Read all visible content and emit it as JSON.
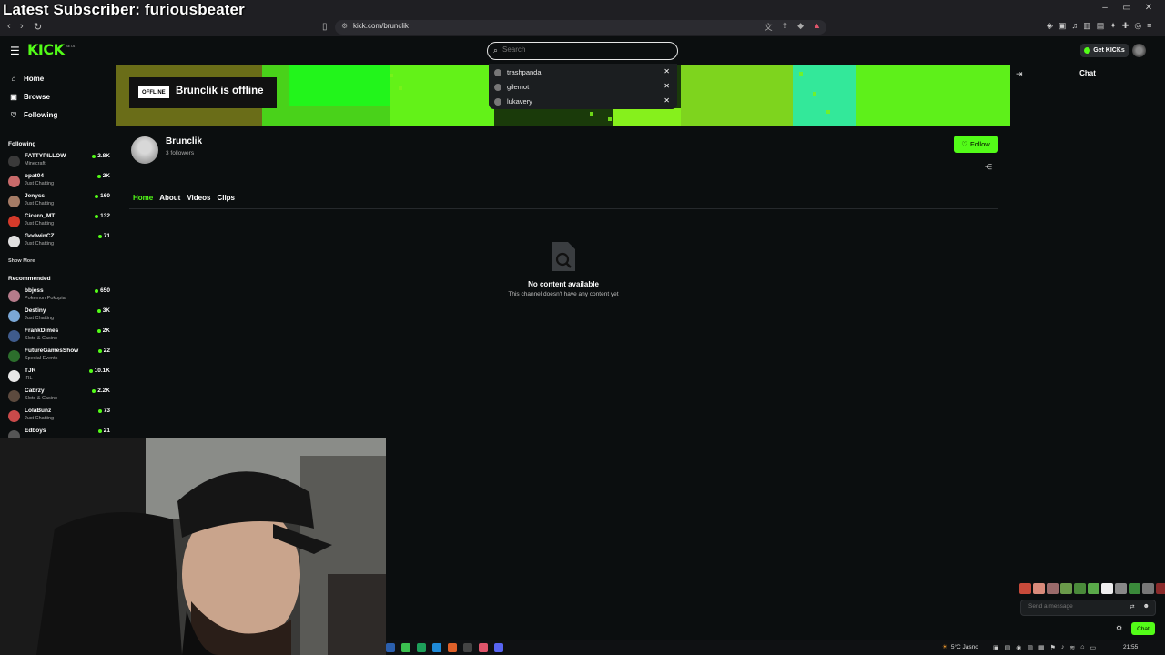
{
  "overlay": {
    "text": "Latest Subscriber: furiousbeater"
  },
  "browser": {
    "url": "kick.com/brunclik",
    "window_controls": [
      "–",
      "▭",
      "✕"
    ]
  },
  "header": {
    "logo": "KICK",
    "beta": "BETA",
    "search_placeholder": "Search",
    "get_kicks": "Get KICKs"
  },
  "search_dropdown": {
    "items": [
      {
        "label": "trashpanda"
      },
      {
        "label": "gilemot"
      },
      {
        "label": "lukavery"
      }
    ]
  },
  "sidebar": {
    "nav": [
      {
        "label": "Home",
        "icon": "home-icon"
      },
      {
        "label": "Browse",
        "icon": "browse-icon"
      },
      {
        "label": "Following",
        "icon": "heart-icon"
      }
    ],
    "following_title": "Following",
    "following": [
      {
        "name": "FATTYPILLOW",
        "category": "Minecraft",
        "viewers": "2.8K",
        "color": "#3a3a3a"
      },
      {
        "name": "opat04",
        "category": "Just Chatting",
        "viewers": "2K",
        "color": "#c86a6a"
      },
      {
        "name": "Jenyss",
        "category": "Just Chatting",
        "viewers": "160",
        "color": "#a57c66"
      },
      {
        "name": "Cicero_MT",
        "category": "Just Chatting",
        "viewers": "132",
        "color": "#d43a2a"
      },
      {
        "name": "GodwinCZ",
        "category": "Just Chatting",
        "viewers": "71",
        "color": "#e0e0e0"
      }
    ],
    "show_more": "Show More",
    "recommended_title": "Recommended",
    "recommended": [
      {
        "name": "bbjess",
        "category": "Pokemon Pokopia",
        "viewers": "650",
        "color": "#b57b8a"
      },
      {
        "name": "Destiny",
        "category": "Just Chatting",
        "viewers": "3K",
        "color": "#7aa7d6"
      },
      {
        "name": "FrankDimes",
        "category": "Slots & Casino",
        "viewers": "2K",
        "color": "#3f5b8c"
      },
      {
        "name": "FutureGamesShow",
        "category": "Special Events",
        "viewers": "22",
        "color": "#2c6e2c"
      },
      {
        "name": "TJR",
        "category": "IRL",
        "viewers": "10.1K",
        "color": "#e8e8e8"
      },
      {
        "name": "Cabrzy",
        "category": "Slots & Casino",
        "viewers": "2.2K",
        "color": "#5c4a3e"
      },
      {
        "name": "LolaBunz",
        "category": "Just Chatting",
        "viewers": "73",
        "color": "#c94a4a"
      },
      {
        "name": "Edboys",
        "category": "",
        "viewers": "21",
        "color": "#555"
      }
    ]
  },
  "banner": {
    "offline_badge": "OFFLINE",
    "offline_title": "Brunclik is offline"
  },
  "channel": {
    "name": "Brunclik",
    "followers": "3 followers",
    "follow_label": "Follow",
    "tabs": [
      "Home",
      "About",
      "Videos",
      "Clips"
    ],
    "active_tab": "Home"
  },
  "empty_state": {
    "title": "No content available",
    "subtitle": "This channel doesn't have any content yet"
  },
  "chat": {
    "title": "Chat",
    "input_placeholder": "Send a message",
    "send_label": "Chat"
  },
  "taskbar": {
    "weather": "5°C  Jasno",
    "time": "21:55"
  },
  "colors": {
    "accent": "#53fc18",
    "background": "#0b0e0f"
  }
}
